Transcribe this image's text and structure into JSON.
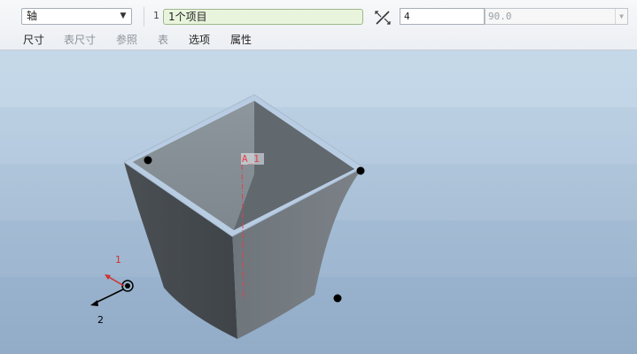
{
  "feature_dashboard": {
    "type_select": {
      "value": "轴"
    },
    "references": {
      "count": "1",
      "value": "1个项目"
    },
    "angle": {
      "value": "4",
      "secondary_value": "90.0"
    }
  },
  "tabs": [
    {
      "label": "尺寸",
      "enabled": true
    },
    {
      "label": "表尺寸",
      "enabled": false
    },
    {
      "label": "参照",
      "enabled": false
    },
    {
      "label": "表",
      "enabled": false
    },
    {
      "label": "选项",
      "enabled": true
    },
    {
      "label": "属性",
      "enabled": true
    }
  ],
  "viewport": {
    "axis_label": "A_1",
    "triad": {
      "axis_1": "1",
      "axis_2": "2"
    }
  },
  "colors": {
    "toolbar_bg": "#eceff3",
    "reference_box": "#e9f4dc",
    "model_gray": "#6d7479",
    "model_edge": "#b8cde2",
    "axis_red": "#e0404a"
  },
  "icons": [
    "dropdown-arrow-icon",
    "flip-direction-icon",
    "coordinate-triad-icon"
  ]
}
